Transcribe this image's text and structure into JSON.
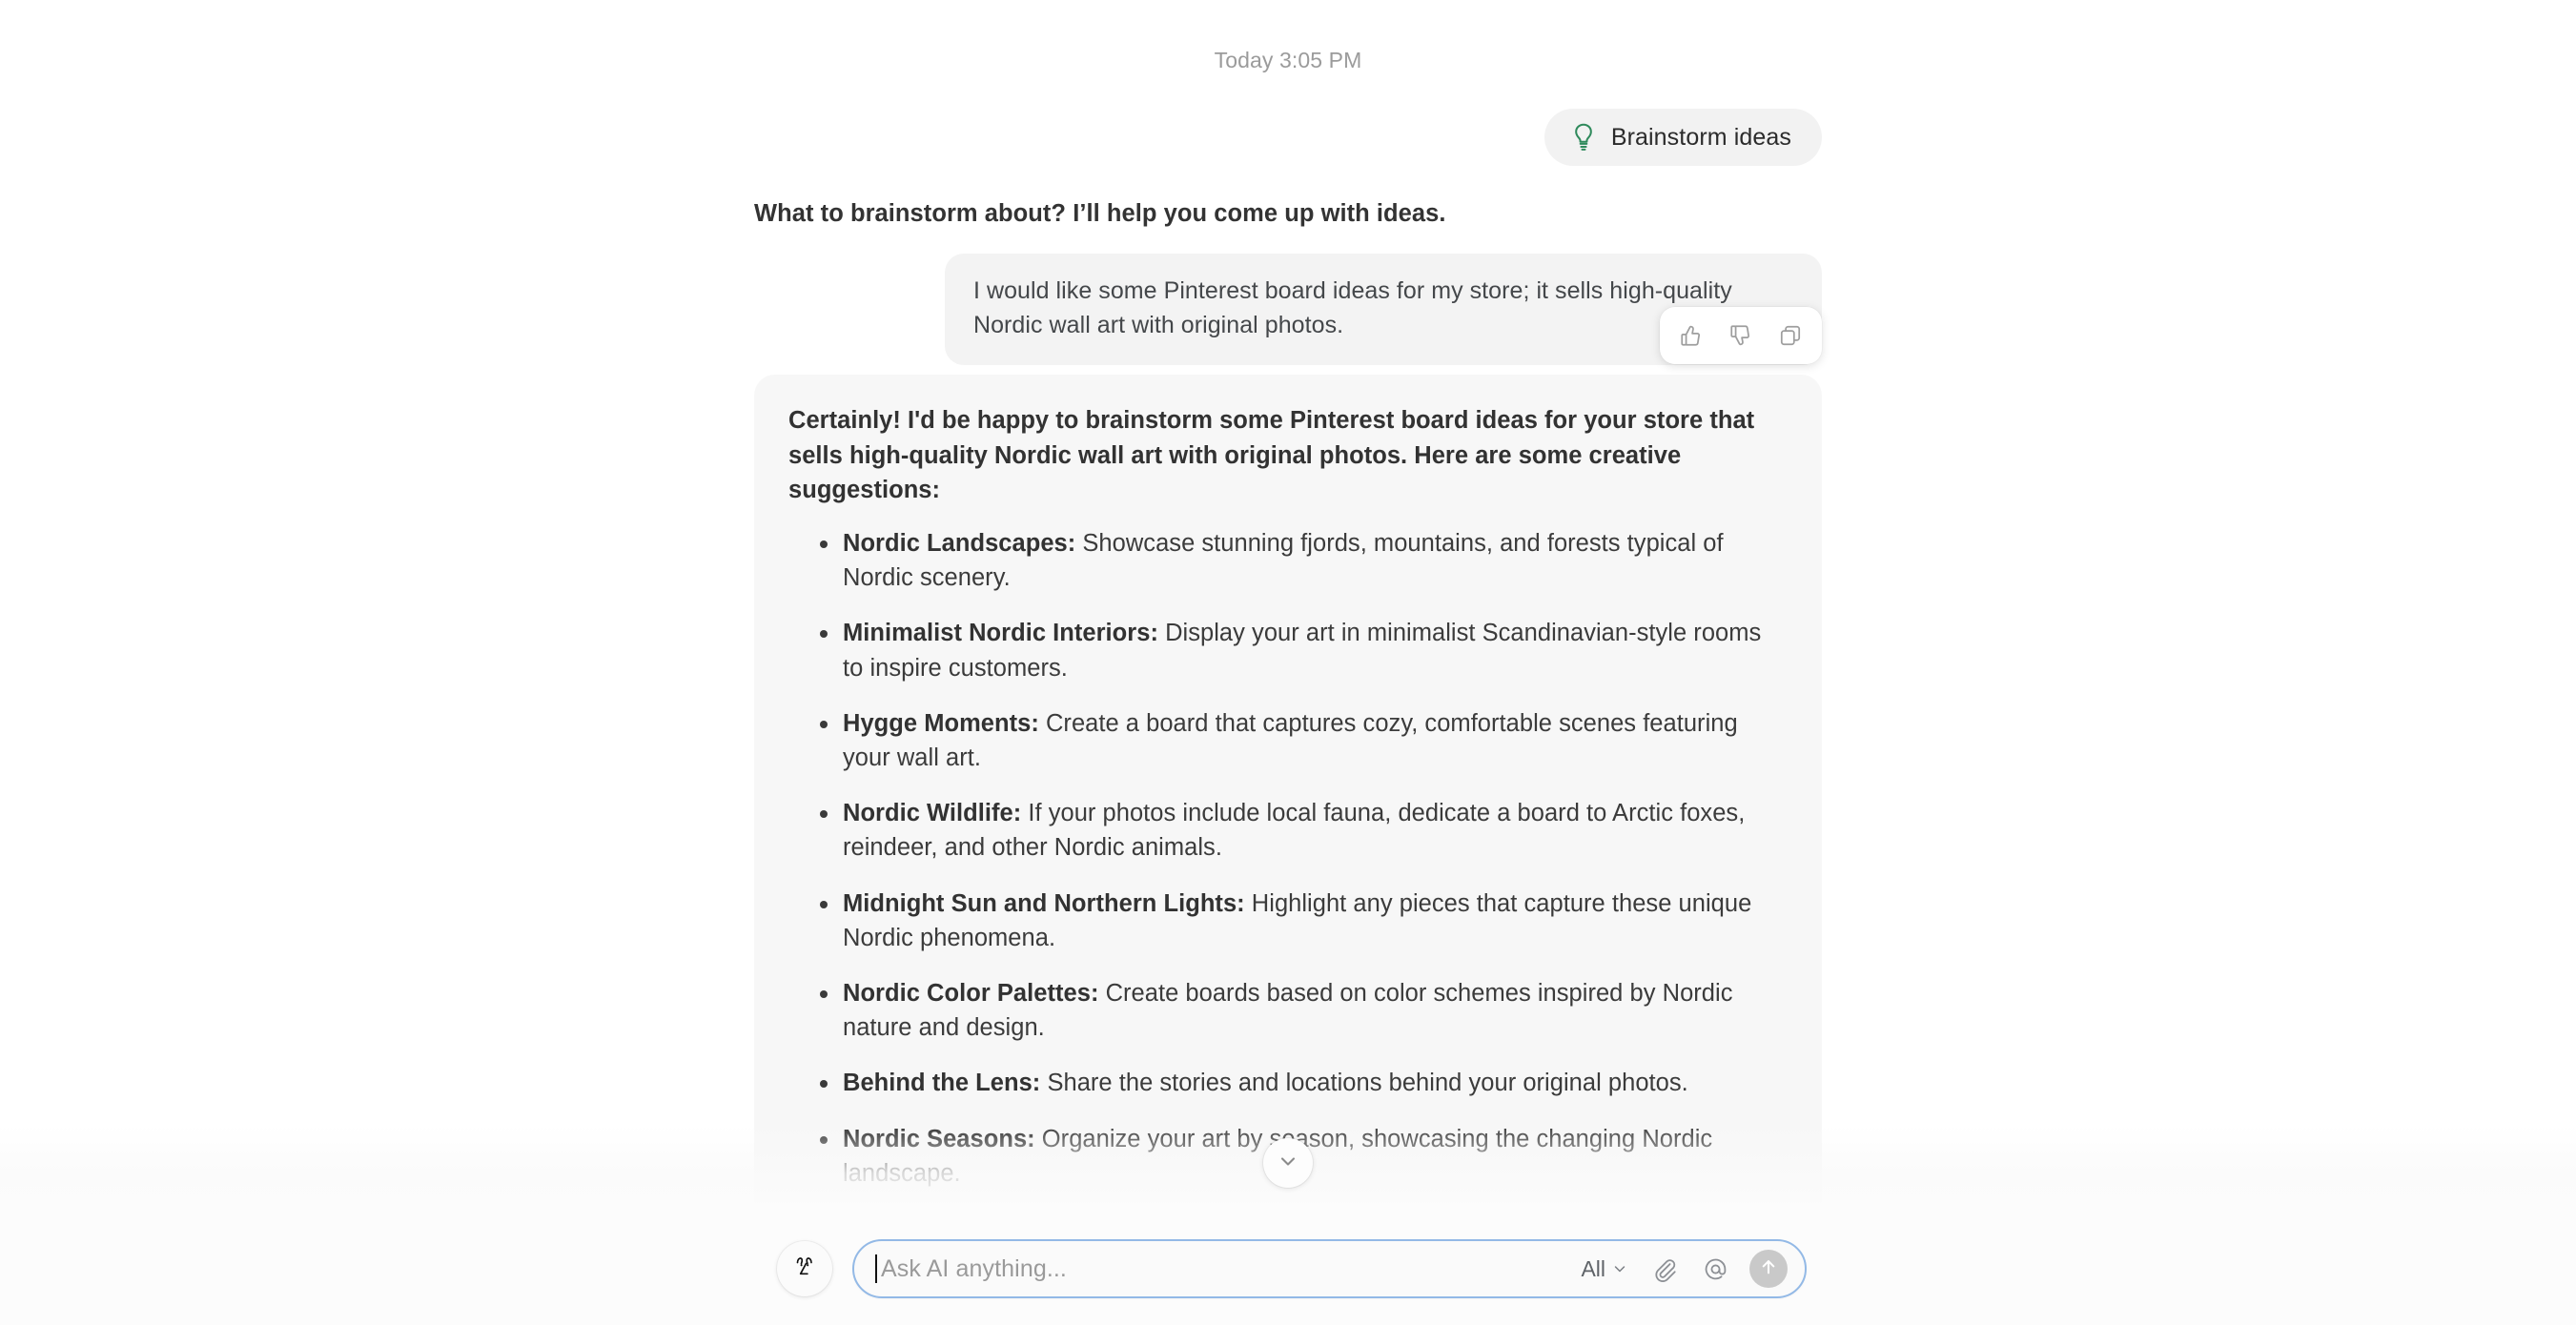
{
  "conversation": {
    "timestamp": "Today 3:05 PM",
    "prompt_chip": {
      "label": "Brainstorm ideas",
      "icon": "lightbulb-icon",
      "icon_color": "#2f8a5c"
    },
    "assistant_intro_line": "What to brainstorm about? I’ll help you come up with ideas.",
    "user_message": "I would like some Pinterest board ideas for my store; it sells high-quality Nordic wall art with original photos.",
    "message_actions": [
      {
        "name": "thumbs-up-icon",
        "label": "Good response"
      },
      {
        "name": "thumbs-down-icon",
        "label": "Bad response"
      },
      {
        "name": "copy-icon",
        "label": "Copy"
      }
    ],
    "answer": {
      "intro": "Certainly! I'd be happy to brainstorm some Pinterest board ideas for your store that sells high-quality Nordic wall art with original photos. Here are some creative suggestions:",
      "ideas": [
        {
          "title": "Nordic Landscapes:",
          "body": " Showcase stunning fjords, mountains, and forests typical of Nordic scenery."
        },
        {
          "title": "Minimalist Nordic Interiors:",
          "body": " Display your art in minimalist Scandinavian-style rooms to inspire customers."
        },
        {
          "title": "Hygge Moments:",
          "body": " Create a board that captures cozy, comfortable scenes featuring your wall art."
        },
        {
          "title": "Nordic Wildlife:",
          "body": " If your photos include local fauna, dedicate a board to Arctic foxes, reindeer, and other Nordic animals."
        },
        {
          "title": "Midnight Sun and Northern Lights:",
          "body": " Highlight any pieces that capture these unique Nordic phenomena."
        },
        {
          "title": "Nordic Color Palettes:",
          "body": " Create boards based on color schemes inspired by Nordic nature and design."
        },
        {
          "title": "Behind the Lens:",
          "body": " Share the stories and locations behind your original photos."
        },
        {
          "title": "Nordic Seasons:",
          "body": " Organize your art by season, showcasing the changing Nordic landscape."
        }
      ]
    }
  },
  "scroll_button": {
    "name": "scroll-to-bottom-button",
    "icon": "chevron-down-icon"
  },
  "composer": {
    "avatar_icon": "ai-assistant-avatar-icon",
    "placeholder": "Ask AI anything...",
    "value": "",
    "scope": {
      "label": "All",
      "icon": "chevron-down-icon"
    },
    "attach_icon": "paperclip-icon",
    "mention_icon": "at-mention-icon",
    "send_icon": "arrow-up-icon"
  },
  "colors": {
    "accent_border": "#93b9e6",
    "bubble_bg": "#f3f3f3",
    "answer_bg": "#f7f7f7",
    "chip_bg": "#f2f2f2",
    "send_bg": "#c9c9c9",
    "timestamp_fg": "#9b9b9b"
  }
}
